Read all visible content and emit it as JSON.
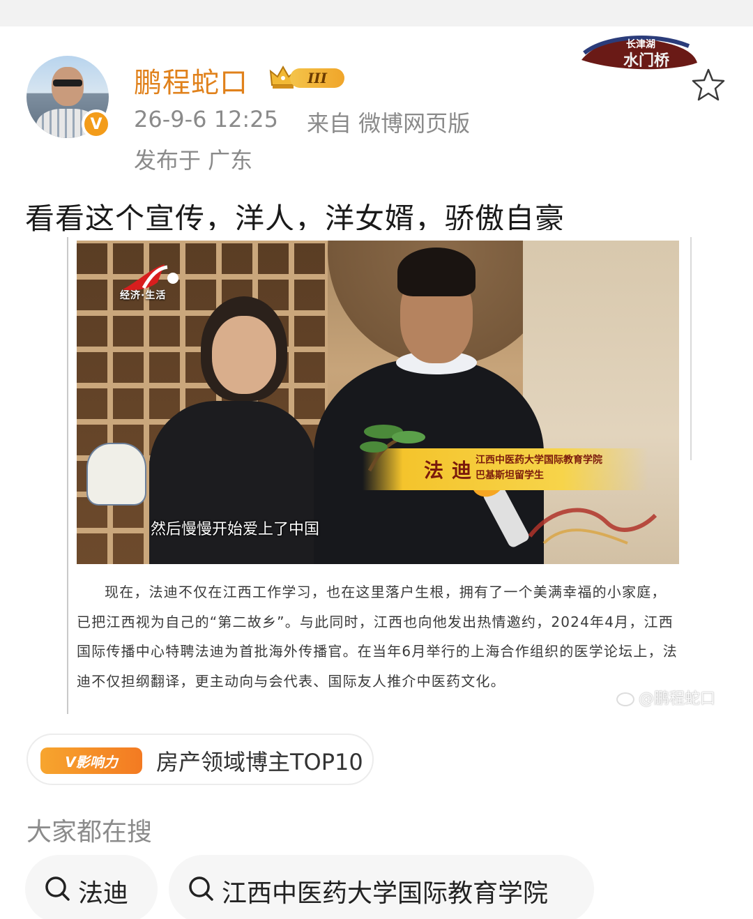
{
  "post": {
    "username": "鹏程蛇口",
    "rank_level": "III",
    "timestamp": "26-9-6 12:25",
    "source": "来自 微博网页版",
    "location": "发布于 广东",
    "text": "看看这个宣传，洋人，洋女婿，骄傲自豪",
    "verified_mark": "V"
  },
  "decal_text": "长津湖 水门桥",
  "video": {
    "channel_label": "经济·生活",
    "subtitle": "然后慢慢开始爱上了中国",
    "nameplate_name": "法迪",
    "nameplate_title_line1": "江西中医药大学国际教育学院",
    "nameplate_title_line2": "巴基斯坦留学生"
  },
  "article_text": "现在，法迪不仅在江西工作学习，也在这里落户生根，拥有了一个美满幸福的小家庭，已把江西视为自己的“第二故乡”。与此同时，江西也向他发出热情邀约，2024年4月，江西国际传播中心特聘法迪为首批海外传播官。在当年6月举行的上海合作组织的医学论坛上，法迪不仅担纲翻译，更主动向与会代表、国际友人推介中医药文化。",
  "watermark": "@鹏程蛇口",
  "influence": {
    "tag": "V影响力",
    "text": "房产领域博主TOP10"
  },
  "search": {
    "heading": "大家都在搜",
    "chips": [
      "法迪",
      "江西中医药大学国际教育学院"
    ]
  },
  "colors": {
    "username": "#e0811b",
    "meta": "#8a8a8a",
    "badge_orange": "#f39c1a"
  },
  "icons": {
    "favorite": "star-outline-icon",
    "search": "magnifier-icon"
  }
}
